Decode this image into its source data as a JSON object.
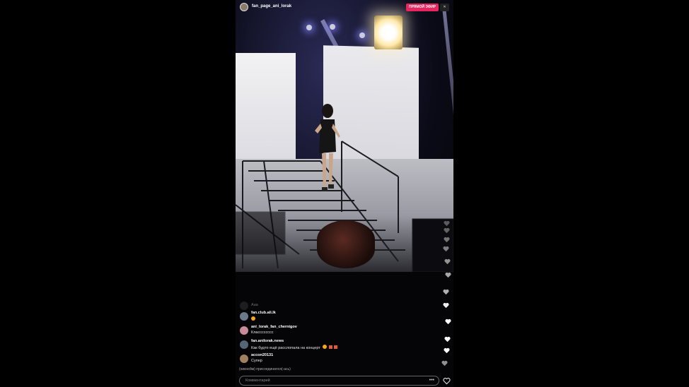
{
  "header": {
    "username": "fan_page_ani_lorak",
    "live_label": "ПРЯМОЙ ЭФИР",
    "close_label": "✕",
    "accent": "#e8255e"
  },
  "comments": [
    {
      "user": "",
      "text": "Ааа",
      "faded": true
    },
    {
      "user": "fan.club.ali.lk",
      "text": "",
      "emoji": true
    },
    {
      "user": "ani_lorak_fan_chernigov",
      "text": "Класссссссс"
    },
    {
      "user": "fan.anilorak.news",
      "text": "Как будто ещё расслопала на концерт"
    },
    {
      "user": "aссоп20131",
      "text": "Супер"
    }
  ],
  "joined_text": "(никнейм) присоединился(-ась)",
  "input": {
    "placeholder": "Комментарий"
  },
  "more_label": "•••"
}
